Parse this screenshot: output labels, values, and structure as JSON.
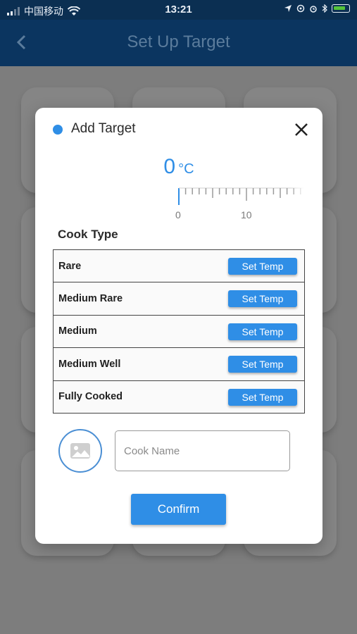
{
  "status_bar": {
    "carrier": "中国移动",
    "time": "13:21"
  },
  "header": {
    "title": "Set Up Target",
    "back_icon": "chevron-left-icon"
  },
  "modal": {
    "title": "Add Target",
    "close_icon": "close-icon",
    "temperature": {
      "value": "0",
      "unit": "°C",
      "ruler_labels": [
        "0",
        "10"
      ]
    },
    "cook_type_label": "Cook Type",
    "cook_types": [
      {
        "name": "Rare",
        "button": "Set Temp"
      },
      {
        "name": "Medium Rare",
        "button": "Set Temp"
      },
      {
        "name": "Medium",
        "button": "Set Temp"
      },
      {
        "name": "Medium Well",
        "button": "Set Temp"
      },
      {
        "name": "Fully Cooked",
        "button": "Set Temp"
      }
    ],
    "image_picker_icon": "image-icon",
    "cook_name_placeholder": "Cook Name",
    "cook_name_value": "",
    "confirm_label": "Confirm"
  },
  "colors": {
    "accent": "#2f8ee6",
    "header_bg": "#0b3560"
  }
}
